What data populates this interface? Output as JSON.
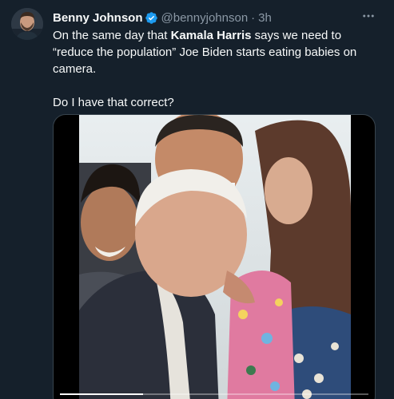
{
  "tweet": {
    "author": {
      "display_name": "Benny Johnson",
      "handle": "@bennyjohnson",
      "verified": true,
      "avatar_icon": "profile-photo"
    },
    "separator": "·",
    "timestamp": "3h",
    "more_icon": "more-horizontal-icon",
    "text": {
      "line1_pre": "On the same day that ",
      "line1_bold": "Kamala Harris",
      "line1_post": " says we need to “reduce the population” Joe Biden starts eating babies on camera.",
      "line2": "Do I have that correct?"
    },
    "media": {
      "type": "video",
      "progress": 0.27
    }
  },
  "colors": {
    "background": "#15202b",
    "text_primary": "#f7f9f9",
    "text_secondary": "#8b98a5",
    "verified_blue": "#1d9bf0",
    "border": "#38444d"
  }
}
